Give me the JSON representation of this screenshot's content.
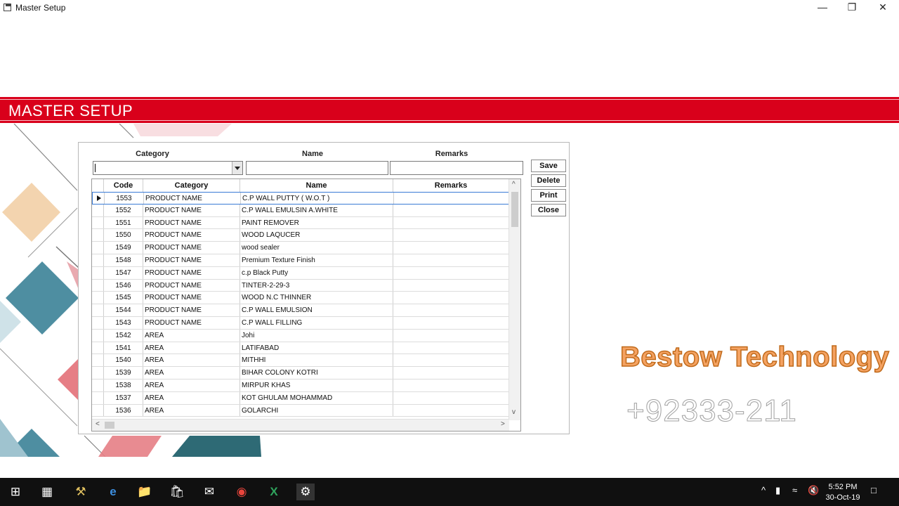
{
  "window": {
    "title": "Master Setup",
    "controls": {
      "minimize": "—",
      "restore": "❐",
      "close": "✕"
    }
  },
  "banner": {
    "title": "MASTER SETUP",
    "color": "#d9001b"
  },
  "form": {
    "labels": {
      "category": "Category",
      "name": "Name",
      "remarks": "Remarks"
    },
    "values": {
      "category": "",
      "name": "",
      "remarks": ""
    }
  },
  "buttons": {
    "save": "Save",
    "delete": "Delete",
    "print": "Print",
    "close": "Close"
  },
  "grid": {
    "columns": [
      "Code",
      "Category",
      "Name",
      "Remarks"
    ],
    "rows": [
      {
        "code": "1553",
        "category": "PRODUCT NAME",
        "name": "C.P WALL PUTTY ( W.O.T )",
        "remarks": ""
      },
      {
        "code": "1552",
        "category": "PRODUCT NAME",
        "name": "C.P WALL EMULSIN A.WHITE",
        "remarks": ""
      },
      {
        "code": "1551",
        "category": "PRODUCT NAME",
        "name": "PAINT REMOVER",
        "remarks": ""
      },
      {
        "code": "1550",
        "category": "PRODUCT NAME",
        "name": "WOOD LAQUCER",
        "remarks": ""
      },
      {
        "code": "1549",
        "category": "PRODUCT NAME",
        "name": "wood sealer",
        "remarks": ""
      },
      {
        "code": "1548",
        "category": "PRODUCT NAME",
        "name": "Premium Texture Finish",
        "remarks": ""
      },
      {
        "code": "1547",
        "category": "PRODUCT NAME",
        "name": "c.p Black Putty",
        "remarks": ""
      },
      {
        "code": "1546",
        "category": "PRODUCT NAME",
        "name": "TINTER-2-29-3",
        "remarks": ""
      },
      {
        "code": "1545",
        "category": "PRODUCT NAME",
        "name": "WOOD N.C THINNER",
        "remarks": ""
      },
      {
        "code": "1544",
        "category": "PRODUCT NAME",
        "name": "C.P WALL EMULSION",
        "remarks": ""
      },
      {
        "code": "1543",
        "category": "PRODUCT NAME",
        "name": "C.P WALL FILLING",
        "remarks": ""
      },
      {
        "code": "1542",
        "category": "AREA",
        "name": "Johi",
        "remarks": ""
      },
      {
        "code": "1541",
        "category": "AREA",
        "name": "LATIFABAD",
        "remarks": ""
      },
      {
        "code": "1540",
        "category": "AREA",
        "name": "MITHHI",
        "remarks": ""
      },
      {
        "code": "1539",
        "category": "AREA",
        "name": "BIHAR COLONY KOTRI",
        "remarks": ""
      },
      {
        "code": "1538",
        "category": "AREA",
        "name": "MIRPUR KHAS",
        "remarks": ""
      },
      {
        "code": "1537",
        "category": "AREA",
        "name": "KOT GHULAM MOHAMMAD",
        "remarks": ""
      },
      {
        "code": "1536",
        "category": "AREA",
        "name": " GOLARCHI",
        "remarks": ""
      }
    ]
  },
  "watermark": {
    "brand": "Bestow Technology",
    "phone": "+92333-211"
  },
  "taskbar": {
    "icons": [
      "windows-start",
      "task-view",
      "tools-app",
      "edge-browser",
      "file-explorer",
      "store",
      "mail",
      "chrome",
      "excel",
      "active-app"
    ],
    "time": "5:52 PM",
    "date": "30-Oct-19"
  }
}
